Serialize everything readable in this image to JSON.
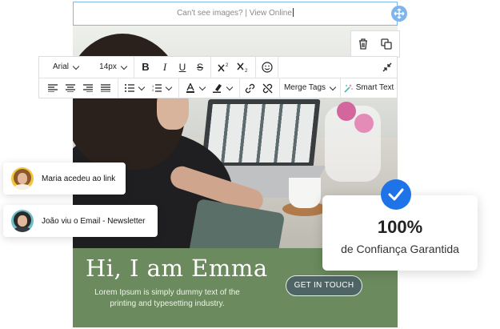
{
  "email": {
    "preheader": "Can't see images? | View Online",
    "hero_title": "Hi, I am Emma",
    "body_text": "Lorem Ipsum is simply dummy text of the printing and typesetting industry.",
    "cta_label": "GET IN TOUCH",
    "band_color": "#6b8a5e"
  },
  "toolbar": {
    "font_family": "Arial",
    "font_size": "14px",
    "bold": "B",
    "italic": "I",
    "underline": "U",
    "strike": "S",
    "merge_tags": "Merge Tags",
    "smart_text": "Smart Text",
    "icons": [
      "bold-icon",
      "italic-icon",
      "underline-icon",
      "strikethrough-icon",
      "superscript-icon",
      "subscript-icon",
      "emoji-icon",
      "collapse-icon",
      "align-left-icon",
      "align-center-icon",
      "align-right-icon",
      "align-justify-icon",
      "bullet-list-icon",
      "numbered-list-icon",
      "text-color-icon",
      "highlight-icon",
      "link-icon",
      "unlink-icon",
      "magic-wand-icon"
    ]
  },
  "notifications": [
    {
      "text": "Maria acedeu ao link"
    },
    {
      "text": "João viu o Email - Newsletter"
    }
  ],
  "trust": {
    "value": "100%",
    "label": "de Confiança Garantida",
    "accent": "#1f73e8"
  }
}
